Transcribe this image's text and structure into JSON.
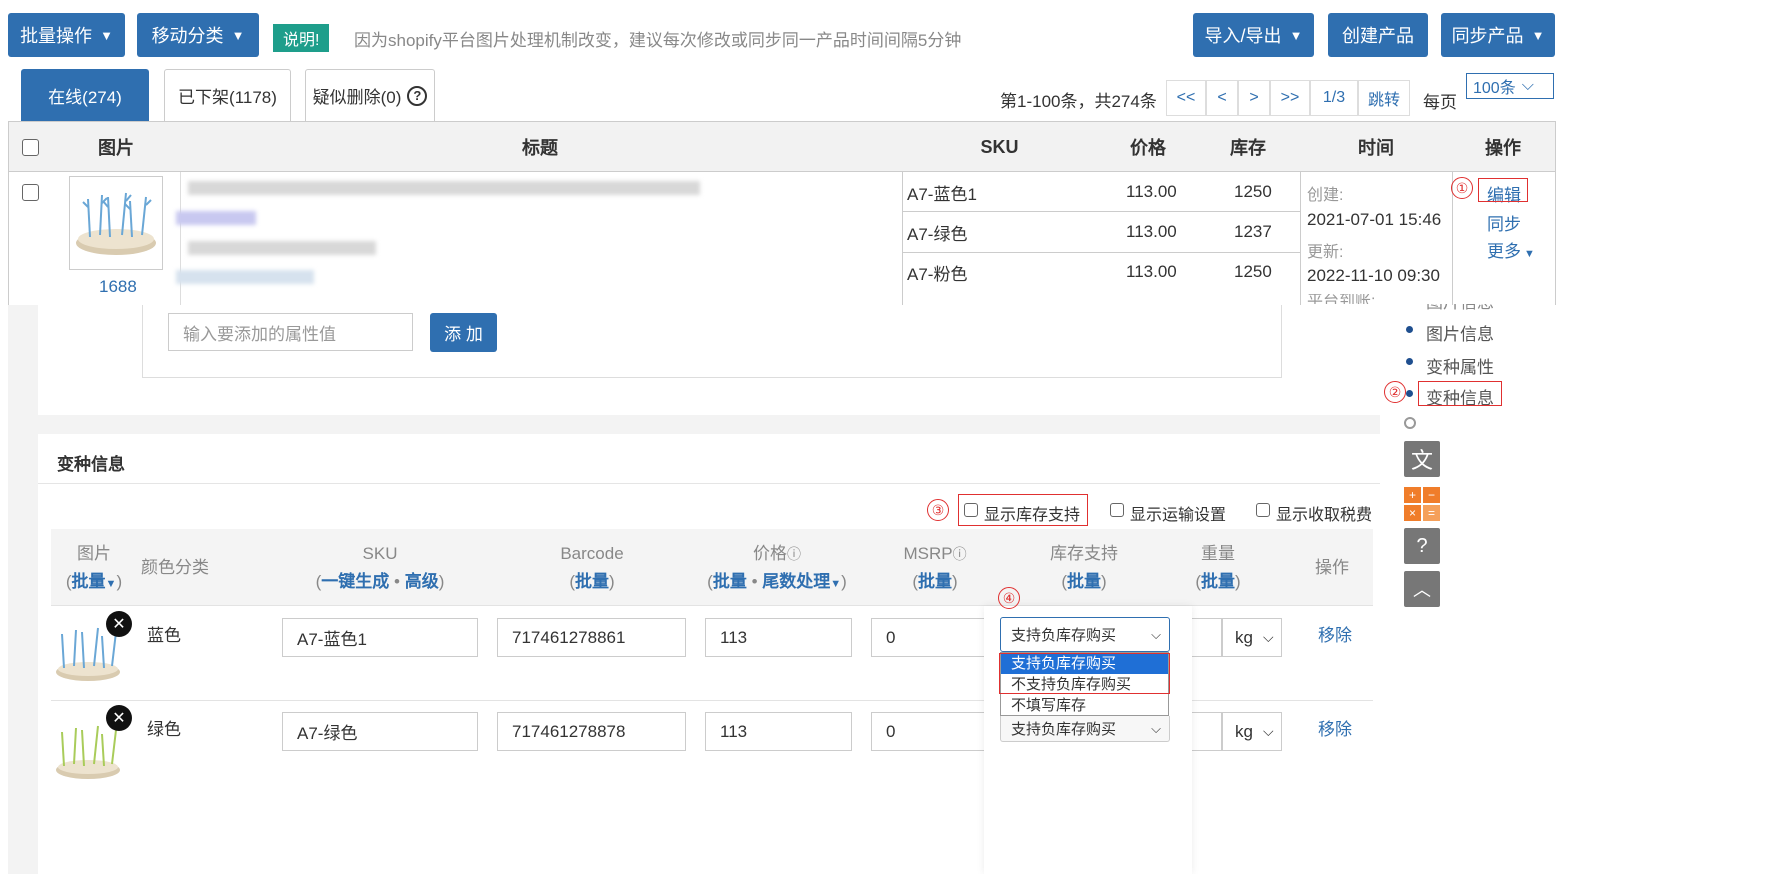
{
  "toolbar": {
    "batch": "批量操作",
    "move": "移动分类",
    "badge": "说明!",
    "note": "因为shopify平台图片处理机制改变，建议每次修改或同步同一产品时间间隔5分钟",
    "import_export": "导入/导出",
    "create": "创建产品",
    "sync": "同步产品"
  },
  "tabs": {
    "online": "在线(274)",
    "offline": "已下架(1178)",
    "deleted": "疑似删除(0)"
  },
  "pagination": {
    "summary": "第1-100条，共274条",
    "first": "<<",
    "prev": "<",
    "next": ">",
    "last": ">>",
    "page": "1/3",
    "jump": "跳转",
    "per_label": "每页",
    "per_value": "100条"
  },
  "table": {
    "headers": {
      "image": "图片",
      "title": "标题",
      "sku": "SKU",
      "price": "价格",
      "stock": "库存",
      "time": "时间",
      "action": "操作"
    },
    "row": {
      "source": "1688",
      "skus": [
        {
          "sku": "A7-蓝色1",
          "price": "113.00",
          "stock": "1250"
        },
        {
          "sku": "A7-绿色",
          "price": "113.00",
          "stock": "1237"
        },
        {
          "sku": "A7-粉色",
          "price": "113.00",
          "stock": "1250"
        }
      ],
      "created_label": "创建:",
      "created": "2021-07-01 15:46",
      "updated_label": "更新:",
      "updated": "2022-11-10 09:30",
      "platform_label": "平台到账:",
      "edit": "编辑",
      "sync": "同步",
      "more": "更多"
    }
  },
  "attr": {
    "placeholder": "输入要添加的属性值",
    "add": "添 加"
  },
  "sidenav": {
    "partial": "图片信息",
    "image": "图片信息",
    "variant_attr": "变种属性",
    "variant_info": "变种信息"
  },
  "variants": {
    "section_title": "变种信息",
    "options": {
      "stock": "显示库存支持",
      "shipping": "显示运输设置",
      "tax": "显示收取税费"
    },
    "headers": {
      "image": "图片",
      "batch": "批量",
      "color": "颜色分类",
      "sku": "SKU",
      "gen": "一键生成",
      "adv": "高级",
      "barcode": "Barcode",
      "price": "价格",
      "tail": "尾数处理",
      "msrp": "MSRP",
      "stock": "库存支持",
      "weight": "重量",
      "action": "操作"
    },
    "rows": [
      {
        "color": "蓝色",
        "sku": "A7-蓝色1",
        "barcode": "717461278861",
        "price": "113",
        "msrp": "0",
        "stock": "支持负库存购买",
        "unit": "kg",
        "remove": "移除"
      },
      {
        "color": "绿色",
        "sku": "A7-绿色",
        "barcode": "717461278878",
        "price": "113",
        "msrp": "0",
        "stock": "支持负库存购买",
        "unit": "kg",
        "remove": "移除"
      }
    ],
    "dropdown": [
      "支持负库存购买",
      "不支持负库存购买",
      "不填写库存"
    ]
  },
  "markers": [
    "①",
    "②",
    "③",
    "④"
  ],
  "colors": {
    "primary": "#2f6fb0",
    "badge": "#1e9e8b",
    "annotation": "#e03030"
  }
}
